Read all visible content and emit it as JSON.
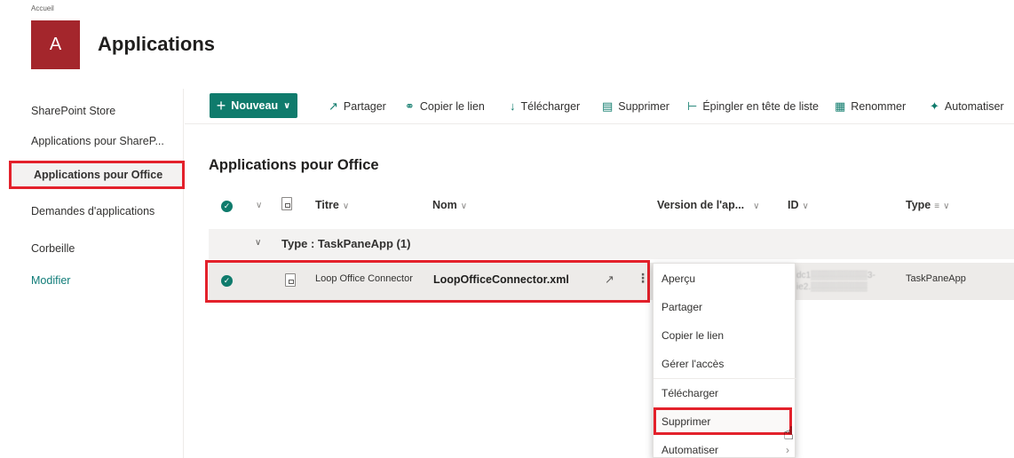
{
  "breadcrumb": "Accueil",
  "site": {
    "logo_letter": "A",
    "title": "Applications",
    "logo_color": "#a4262c"
  },
  "nav": {
    "items": [
      {
        "label": "SharePoint Store"
      },
      {
        "label": "Applications pour ShareP..."
      },
      {
        "label": "Applications pour Office"
      },
      {
        "label": "Demandes d'applications"
      },
      {
        "label": "Corbeille"
      },
      {
        "label": "Modifier"
      }
    ]
  },
  "toolbar": {
    "new_label": "Nouveau",
    "share": "Partager",
    "copy_link": "Copier le lien",
    "download": "Télécharger",
    "delete": "Supprimer",
    "pin": "Épingler en tête de liste",
    "rename": "Renommer",
    "automate": "Automatiser",
    "accent": "#0f7b6c"
  },
  "section_title": "Applications pour Office",
  "columns": {
    "title": "Titre",
    "name": "Nom",
    "version": "Version de l'ap...",
    "id": "ID",
    "type": "Type"
  },
  "group": {
    "label": "Type : TaskPaneApp (1)"
  },
  "row": {
    "title": "Loop Office Connector",
    "name": "LoopOfficeConnector.xml",
    "id_line1": "dc1▒▒▒▒▒▒▒▒▒3-",
    "id_line2": "ie2.▒▒▒▒▒▒▒▒▒",
    "type": "TaskPaneApp"
  },
  "context_menu": {
    "items": [
      "Aperçu",
      "Partager",
      "Copier le lien",
      "Gérer l'accès",
      "Télécharger",
      "Supprimer",
      "Automatiser"
    ]
  },
  "highlight_color": "#e3212b"
}
